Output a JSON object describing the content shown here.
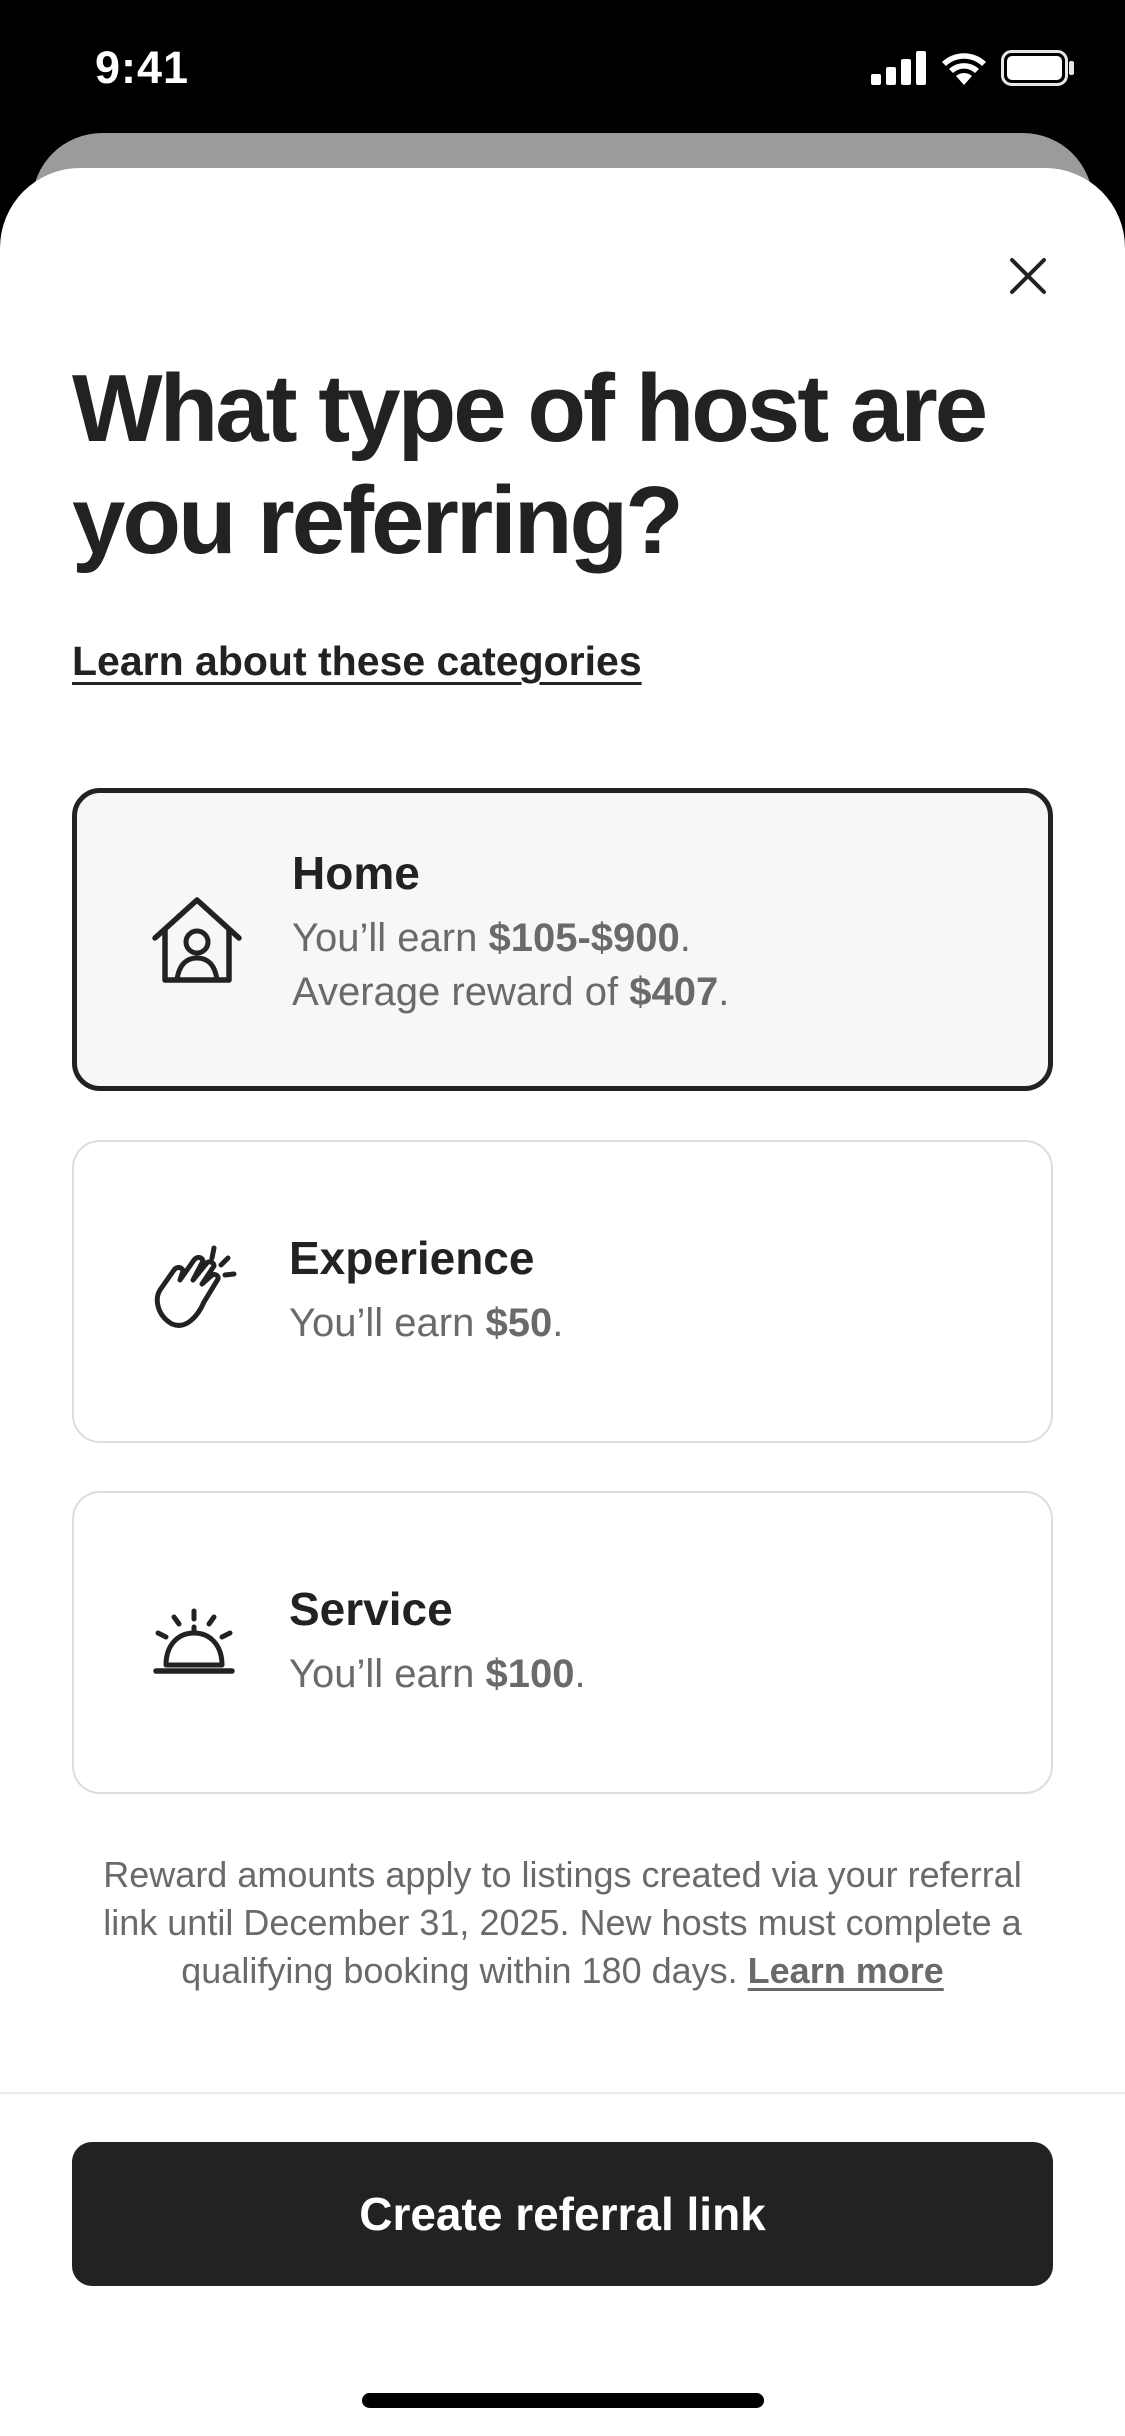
{
  "status_bar": {
    "time": "9:41"
  },
  "sheet": {
    "title": "What type of host are you referring?",
    "learn_link": "Learn about these categories",
    "options": [
      {
        "id": "home",
        "icon": "house-person-icon",
        "title": "Home",
        "line1_prefix": "You’ll earn ",
        "line1_amount": "$105-$900",
        "line1_suffix": ".",
        "line2_prefix": "Average reward of ",
        "line2_amount": "$407",
        "line2_suffix": ".",
        "selected": true
      },
      {
        "id": "experience",
        "icon": "waving-hand-icon",
        "title": "Experience",
        "line1_prefix": "You’ll earn ",
        "line1_amount": "$50",
        "line1_suffix": ".",
        "selected": false
      },
      {
        "id": "service",
        "icon": "service-bell-icon",
        "title": "Service",
        "line1_prefix": "You’ll earn ",
        "line1_amount": "$100",
        "line1_suffix": ".",
        "selected": false
      }
    ],
    "disclaimer": "Reward amounts apply to listings created via your referral link until December 31, 2025. New hosts must complete a qualifying booking within 180 days.",
    "disclaimer_link": "Learn more",
    "cta_label": "Create referral link"
  },
  "colors": {
    "text_primary": "#222222",
    "text_secondary": "#6a6a6a",
    "selected_card_bg": "#f7f7f7",
    "button_bg": "#222222"
  }
}
